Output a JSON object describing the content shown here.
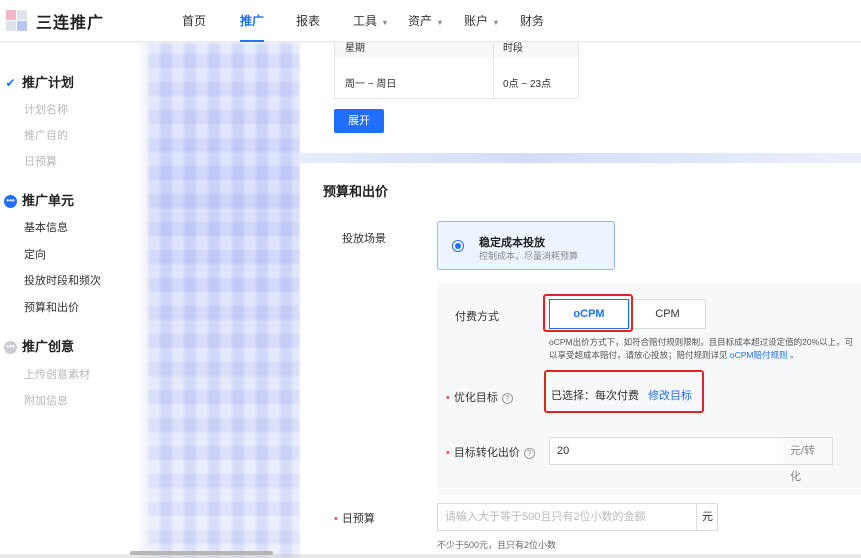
{
  "brand": {
    "name": "三连推广"
  },
  "nav": {
    "items": [
      {
        "label": "首页",
        "dropdown": false,
        "active": false
      },
      {
        "label": "推广",
        "dropdown": false,
        "active": true
      },
      {
        "label": "报表",
        "dropdown": false,
        "active": false
      },
      {
        "label": "工具",
        "dropdown": true,
        "active": false
      },
      {
        "label": "资产",
        "dropdown": true,
        "active": false
      },
      {
        "label": "账户",
        "dropdown": true,
        "active": false
      },
      {
        "label": "财务",
        "dropdown": false,
        "active": false
      }
    ]
  },
  "sidebar": {
    "plan": {
      "title": "推广计划",
      "items": [
        "计划名称",
        "推广目的",
        "日预算"
      ]
    },
    "unit": {
      "title": "推广单元",
      "items": [
        "基本信息",
        "定向",
        "投放时段和频次",
        "预算和出价"
      ]
    },
    "creative": {
      "title": "推广创意",
      "items": [
        "上传创意素材",
        "附加信息"
      ]
    }
  },
  "schedule": {
    "headers": [
      "星期",
      "时段"
    ],
    "row": [
      "周一 ~ 周日",
      "0点 ~ 23点"
    ],
    "expand_label": "展开"
  },
  "budget": {
    "section_title": "预算和出价",
    "scene_label": "投放场景",
    "scene_option": {
      "title": "稳定成本投放",
      "desc": "控制成本，尽量消耗预算"
    },
    "payment_label": "付费方式",
    "payment_options": [
      "oCPM",
      "CPM"
    ],
    "payment_selected": "oCPM",
    "note_text": "oCPM出价方式下，如符合赔付规则限制，且目标成本超过设定值的20%以上，可以享受超成本赔付，请放心投放；赔付规则详见 ",
    "note_link": "oCPM赔付规则",
    "note_end": " 。",
    "goal_label": "优化目标",
    "goal_selected": "已选择：每次付费",
    "goal_edit": "修改目标",
    "bid_label": "目标转化出价",
    "bid_value": "20",
    "bid_suffix": "元/转化",
    "daily_label": "日预算",
    "daily_placeholder": "请输入大于等于500且只有2位小数的金额",
    "daily_suffix": "元",
    "daily_hint": "不少于500元，且只有2位小数"
  },
  "colors": {
    "accent": "#1e6fff",
    "highlight": "#e0261e"
  }
}
